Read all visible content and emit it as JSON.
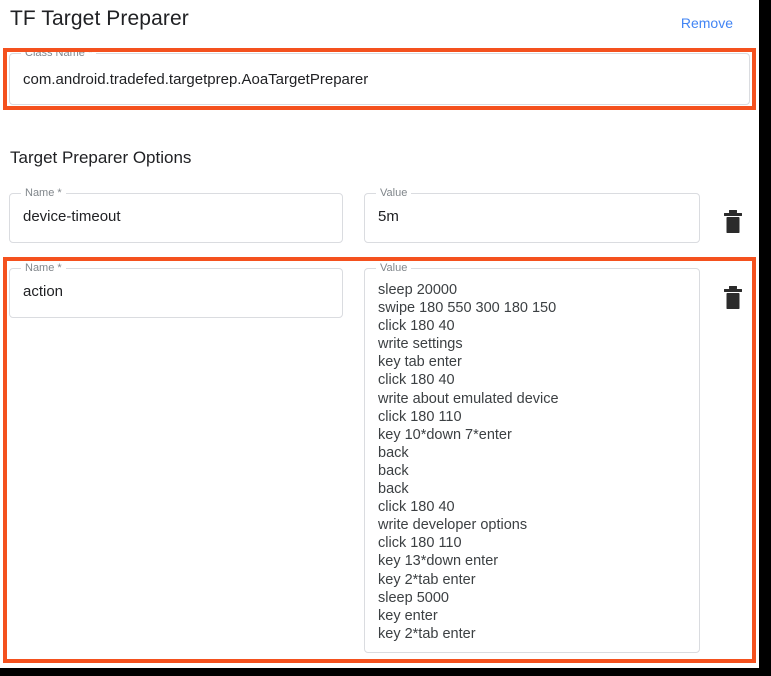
{
  "header": {
    "title": "TF Target Preparer",
    "remove_label": "Remove",
    "remove_color": "#4285f4"
  },
  "class_name_field": {
    "legend": "Class Name *",
    "value": "com.android.tradefed.targetprep.AoaTargetPreparer"
  },
  "options_section": {
    "title": "Target Preparer Options",
    "rows": [
      {
        "name_legend": "Name *",
        "name_value": "device-timeout",
        "value_legend": "Value",
        "value_value": "5m",
        "delete_icon": "trash-icon"
      },
      {
        "name_legend": "Name *",
        "name_value": "action",
        "value_legend": "Value",
        "value_value": "sleep 20000\nswipe 180 550 300 180 150\nclick 180 40\nwrite settings\nkey tab enter\nclick 180 40\nwrite about emulated device\nclick 180 110\nkey 10*down 7*enter\nback\nback\nback\nclick 180 40\nwrite developer options\nclick 180 110\nkey 13*down enter\nkey 2*tab enter\nsleep 5000\nkey enter\nkey 2*tab enter",
        "delete_icon": "trash-icon"
      }
    ]
  },
  "highlights": {
    "color": "#f4511e",
    "regions": [
      "class-name-field",
      "second-option-row"
    ]
  }
}
